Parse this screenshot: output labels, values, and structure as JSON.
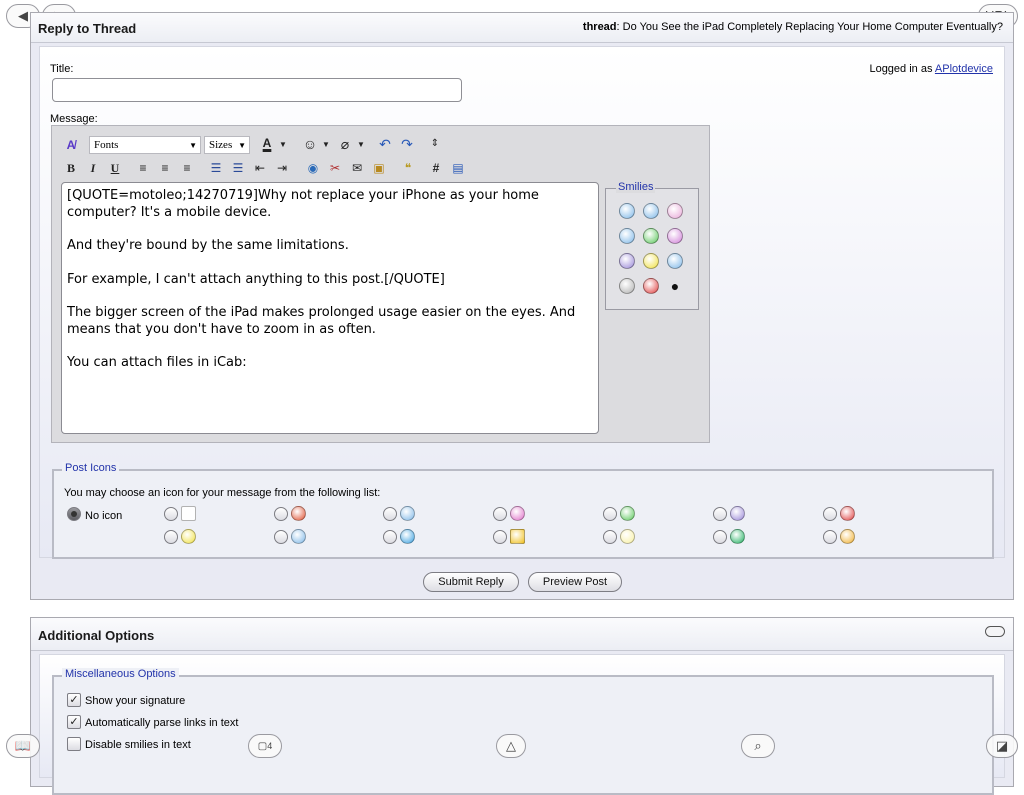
{
  "reply_panel": {
    "title": "Reply to Thread",
    "thread_label": "thread",
    "thread_title": ": Do You See the iPad Completely Replacing Your Home Computer Eventually?",
    "title_label": "Title:",
    "title_value": "",
    "logged_in_prefix": "Logged in as ",
    "username": "APlotdevice",
    "message_label": "Message:"
  },
  "toolbar": {
    "fonts": "Fonts",
    "sizes": "Sizes",
    "bold": "B",
    "italic": "I",
    "underline": "U",
    "hash": "#"
  },
  "message_text": "[QUOTE=motoleo;14270719]Why not replace your iPhone as your home computer? It's a mobile device.\n\nAnd they're bound by the same limitations.\n\nFor example, I can't attach anything to this post.[/QUOTE]\n\nThe bigger screen of the iPad makes prolonged usage easier on the eyes. And means that you don't have to zoom in as often.\n\nYou can attach files in iCab:",
  "smilies": {
    "legend": "Smilies",
    "items": [
      {
        "icon": "smile-icon",
        "color": "#7fb8e8"
      },
      {
        "icon": "cool-icon",
        "color": "#7fb8e8"
      },
      {
        "icon": "tongue-icon",
        "color": "#e8a8d8"
      },
      {
        "icon": "wink-icon",
        "color": "#7fb8e8"
      },
      {
        "icon": "grin-icon",
        "color": "#5cc85c"
      },
      {
        "icon": "biggrin-icon",
        "color": "#d080d8"
      },
      {
        "icon": "frown-icon",
        "color": "#9a88d8"
      },
      {
        "icon": "yellow-smile-icon",
        "color": "#f0e040"
      },
      {
        "icon": "confused-icon",
        "color": "#7fb8e8"
      },
      {
        "icon": "eek-icon",
        "color": "#b0b0b0"
      },
      {
        "icon": "mad-icon",
        "color": "#e04040"
      },
      {
        "icon": "apple-icon",
        "color": "#111111"
      }
    ]
  },
  "post_icons": {
    "legend": "Post Icons",
    "instruction": "You may choose an icon for your message from the following list:",
    "no_icon_label": "No icon",
    "icons": [
      {
        "icon": "post-icon",
        "color": "#ffffff"
      },
      {
        "icon": "thumbs-down-icon",
        "color": "#e05030"
      },
      {
        "icon": "wink-icon",
        "color": "#7fb8e8"
      },
      {
        "icon": "biggrin-icon",
        "color": "#e070c8"
      },
      {
        "icon": "grin-icon",
        "color": "#5cc85c"
      },
      {
        "icon": "frown-icon",
        "color": "#9a88d8"
      },
      {
        "icon": "mad-icon",
        "color": "#e04040"
      },
      {
        "icon": "smile-icon",
        "color": "#f0e040"
      },
      {
        "icon": "cool-icon",
        "color": "#7fb8e8"
      },
      {
        "icon": "question-icon",
        "color": "#3aa0e0"
      },
      {
        "icon": "exclamation-icon",
        "color": "#f0c020"
      },
      {
        "icon": "lightbulb-icon",
        "color": "#f8f0a0"
      },
      {
        "icon": "arrow-icon",
        "color": "#20b060"
      },
      {
        "icon": "thumbs-up-icon",
        "color": "#f0b030"
      }
    ]
  },
  "buttons": {
    "submit": "Submit Reply",
    "preview": "Preview Post"
  },
  "additional": {
    "title": "Additional Options",
    "misc_legend": "Miscellaneous Options",
    "options": [
      {
        "label": "Show your signature",
        "checked": true
      },
      {
        "label": "Automatically parse links in text",
        "checked": true
      },
      {
        "label": "Disable smilies in text",
        "checked": false
      }
    ]
  },
  "browser": {
    "url_label": "URL",
    "tabs_count": "4"
  }
}
